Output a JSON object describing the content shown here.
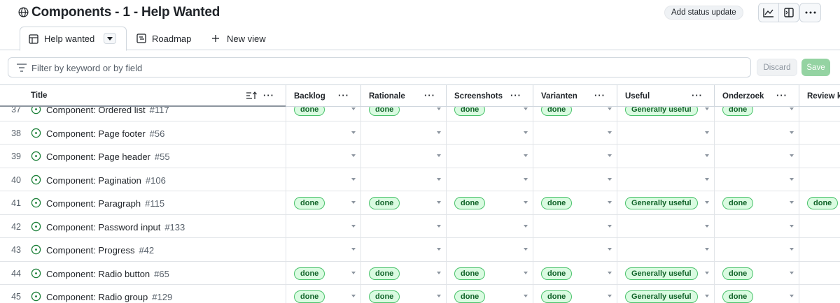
{
  "header": {
    "title": "Components - 1 - Help Wanted",
    "status_button": "Add status update"
  },
  "tabs": [
    {
      "label": "Help wanted",
      "icon": "table-icon",
      "active": true
    },
    {
      "label": "Roadmap",
      "icon": "roadmap-icon",
      "active": false
    },
    {
      "label": "New view",
      "icon": "plus-icon",
      "active": false
    }
  ],
  "filter": {
    "placeholder": "Filter by keyword or by field",
    "value": "",
    "discard_label": "Discard",
    "save_label": "Save"
  },
  "columns": [
    {
      "key": "title",
      "label": "Title"
    },
    {
      "key": "backlog",
      "label": "Backlog"
    },
    {
      "key": "rationale",
      "label": "Rationale"
    },
    {
      "key": "screenshots",
      "label": "Screenshots"
    },
    {
      "key": "varianten",
      "label": "Varianten"
    },
    {
      "key": "useful",
      "label": "Useful"
    },
    {
      "key": "onderzoek",
      "label": "Onderzoek"
    },
    {
      "key": "review",
      "label": "Review k"
    }
  ],
  "rows": [
    {
      "num": "37",
      "title": "Component: Ordered list",
      "issue": "#117",
      "backlog": "done",
      "rationale": "done",
      "screenshots": "done",
      "varianten": "done",
      "useful": "Generally useful",
      "onderzoek": "done",
      "review": ""
    },
    {
      "num": "38",
      "title": "Component: Page footer",
      "issue": "#56",
      "backlog": "",
      "rationale": "",
      "screenshots": "",
      "varianten": "",
      "useful": "",
      "onderzoek": "",
      "review": ""
    },
    {
      "num": "39",
      "title": "Component: Page header",
      "issue": "#55",
      "backlog": "",
      "rationale": "",
      "screenshots": "",
      "varianten": "",
      "useful": "",
      "onderzoek": "",
      "review": ""
    },
    {
      "num": "40",
      "title": "Component: Pagination",
      "issue": "#106",
      "backlog": "",
      "rationale": "",
      "screenshots": "",
      "varianten": "",
      "useful": "",
      "onderzoek": "",
      "review": ""
    },
    {
      "num": "41",
      "title": "Component: Paragraph",
      "issue": "#115",
      "backlog": "done",
      "rationale": "done",
      "screenshots": "done",
      "varianten": "done",
      "useful": "Generally useful",
      "onderzoek": "done",
      "review": "done"
    },
    {
      "num": "42",
      "title": "Component: Password input",
      "issue": "#133",
      "backlog": "",
      "rationale": "",
      "screenshots": "",
      "varianten": "",
      "useful": "",
      "onderzoek": "",
      "review": ""
    },
    {
      "num": "43",
      "title": "Component: Progress",
      "issue": "#42",
      "backlog": "",
      "rationale": "",
      "screenshots": "",
      "varianten": "",
      "useful": "",
      "onderzoek": "",
      "review": ""
    },
    {
      "num": "44",
      "title": "Component: Radio button",
      "issue": "#65",
      "backlog": "done",
      "rationale": "done",
      "screenshots": "done",
      "varianten": "done",
      "useful": "Generally useful",
      "onderzoek": "done",
      "review": ""
    },
    {
      "num": "45",
      "title": "Component: Radio group",
      "issue": "#129",
      "backlog": "done",
      "rationale": "done",
      "screenshots": "done",
      "varianten": "done",
      "useful": "Generally useful",
      "onderzoek": "done",
      "review": ""
    }
  ],
  "colors": {
    "pill_bg": "#dafbe1",
    "pill_border": "#4ac26b",
    "pill_text": "#116329",
    "open_issue": "#1a7f37",
    "save_button": "#94d3a2"
  }
}
